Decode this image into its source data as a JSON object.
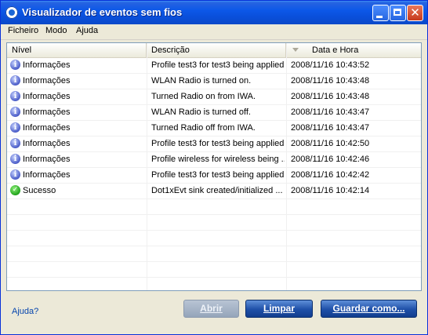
{
  "window": {
    "title": "Visualizador de eventos sem fios"
  },
  "menu": [
    "Ficheiro",
    "Modo",
    "Ajuda"
  ],
  "columns": {
    "nivel": "Nível",
    "descricao": "Descrição",
    "data": "Data e Hora"
  },
  "rows": [
    {
      "icon": "info-icon",
      "nivel": "Informações",
      "descricao": "Profile test3 for test3 being applied.",
      "data": "2008/11/16 10:43:52"
    },
    {
      "icon": "info-icon",
      "nivel": "Informações",
      "descricao": "WLAN Radio is turned on.",
      "data": "2008/11/16 10:43:48"
    },
    {
      "icon": "info-icon",
      "nivel": "Informações",
      "descricao": "Turned Radio on from IWA.",
      "data": "2008/11/16 10:43:48"
    },
    {
      "icon": "info-icon",
      "nivel": "Informações",
      "descricao": "WLAN Radio is turned off.",
      "data": "2008/11/16 10:43:47"
    },
    {
      "icon": "info-icon",
      "nivel": "Informações",
      "descricao": "Turned Radio off from IWA.",
      "data": "2008/11/16 10:43:47"
    },
    {
      "icon": "info-icon",
      "nivel": "Informações",
      "descricao": "Profile test3 for test3 being applied.",
      "data": "2008/11/16 10:42:50"
    },
    {
      "icon": "info-icon",
      "nivel": "Informações",
      "descricao": "Profile wireless for wireless being ...",
      "data": "2008/11/16 10:42:46"
    },
    {
      "icon": "info-icon",
      "nivel": "Informações",
      "descricao": "Profile test3 for test3 being applied.",
      "data": "2008/11/16 10:42:42"
    },
    {
      "icon": "success-icon",
      "nivel": "Sucesso",
      "descricao": "Dot1xEvt sink created/initialized ...",
      "data": "2008/11/16 10:42:14"
    }
  ],
  "empty_rows": 7,
  "footer": {
    "help": "Ajuda?",
    "abrir": "Abrir",
    "limpar": "Limpar",
    "guardar": "Guardar como..."
  },
  "colors": {
    "titlebar": "#0A49C8",
    "window_bg": "#ECE9D8",
    "button": "#1E4FA8"
  }
}
